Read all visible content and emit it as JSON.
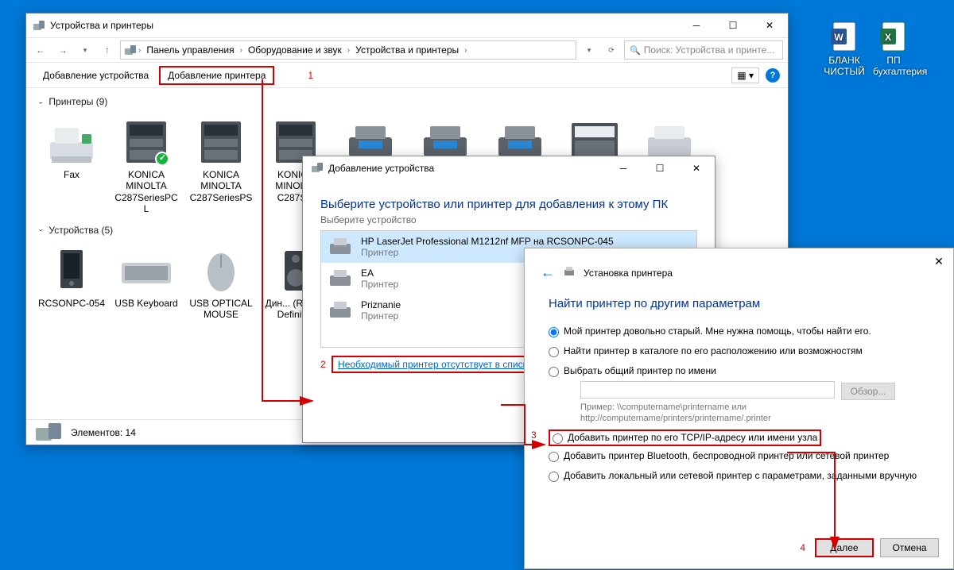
{
  "desktop": {
    "icons": [
      {
        "label": "БЛАНК ЧИСТЫЙ",
        "type": "word"
      },
      {
        "label": "ПП бухгалтерия",
        "type": "excel"
      }
    ]
  },
  "explorer": {
    "title": "Устройства и принтеры",
    "breadcrumb": [
      "Панель управления",
      "Оборудование и звук",
      "Устройства и принтеры"
    ],
    "search_placeholder": "Поиск: Устройства и принте...",
    "cmd_add_device": "Добавление устройства",
    "cmd_add_printer": "Добавление принтера",
    "group_printers": "Принтеры (9)",
    "group_devices": "Устройства (5)",
    "printers": [
      {
        "name": "Fax"
      },
      {
        "name": "KONICA MINOLTA C287SeriesPCL"
      },
      {
        "name": "KONICA MINOLTA C287SeriesPS"
      },
      {
        "name": "KONICA MINOLTA C287S..."
      },
      {
        "name": ""
      },
      {
        "name": ""
      },
      {
        "name": ""
      },
      {
        "name": ""
      },
      {
        "name": ""
      }
    ],
    "devices": [
      {
        "name": "RCSONPC-054"
      },
      {
        "name": "USB Keyboard"
      },
      {
        "name": "USB OPTICAL MOUSE"
      },
      {
        "name": "Дин... (Realt... Definiti..."
      }
    ],
    "status_count": "Элементов: 14"
  },
  "dialog2": {
    "window_title": "Добавление устройства",
    "heading": "Выберите устройство или принтер для добавления к этому ПК",
    "sub": "Выберите устройство",
    "items": [
      {
        "name": "HP LaserJet Professional M1212nf MFP на RCSONPC-045",
        "type": "Принтер",
        "selected": true
      },
      {
        "name": "EA",
        "type": "Принтер",
        "selected": false
      },
      {
        "name": "Priznanie",
        "type": "Принтер",
        "selected": false
      }
    ],
    "missing_link": "Необходимый принтер отсутствует в списке"
  },
  "dialog3": {
    "window_title": "Установка принтера",
    "heading": "Найти принтер по другим параметрам",
    "opts": [
      "Мой принтер довольно старый. Мне нужна помощь, чтобы найти его.",
      "Найти принтер в каталоге по его расположению или возможностям",
      "Выбрать общий принтер по имени",
      "Добавить принтер по его TCP/IP-адресу или имени узла",
      "Добавить принтер Bluetooth, беспроводной принтер или сетевой принтер",
      "Добавить локальный или сетевой принтер с параметрами, заданными вручную"
    ],
    "example1": "Пример: \\\\computername\\printername или",
    "example2": "http://computername/printers/printername/.printer",
    "browse_label": "Обзор...",
    "next": "Далее",
    "cancel": "Отмена"
  },
  "annotations": {
    "n1": "1",
    "n2": "2",
    "n3": "3",
    "n4": "4"
  }
}
